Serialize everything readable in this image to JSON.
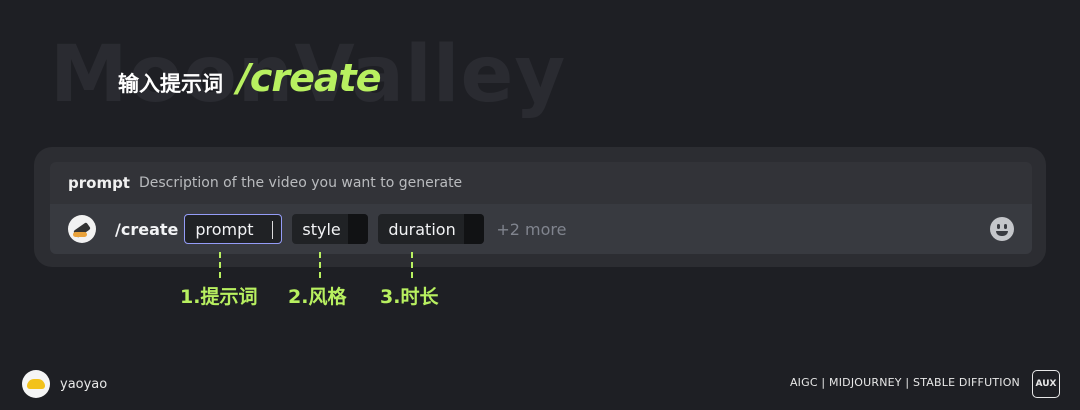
{
  "watermark": "MoonValley",
  "title": {
    "cn": "输入提示词",
    "command": "/create"
  },
  "hint": {
    "key": "prompt",
    "description": "Description of the video you want to generate"
  },
  "input": {
    "bot_icon": "bot-avatar-icon",
    "command": "/create",
    "options": [
      "prompt",
      "style",
      "duration"
    ],
    "more": "+2 more",
    "emoji_icon": "emoji-icon"
  },
  "labels": [
    "1.提示词",
    "2.风格",
    "3.时长"
  ],
  "footer": {
    "author": "yaoyao",
    "tags": "AIGC | MIDJOURNEY | STABLE DIFFUTION",
    "badge": "AUX"
  },
  "colors": {
    "background": "#1e1f24",
    "accent": "#b8f060",
    "panel": "#2c2d32",
    "input_bar": "#383a40",
    "focus_border": "#949cf7"
  }
}
